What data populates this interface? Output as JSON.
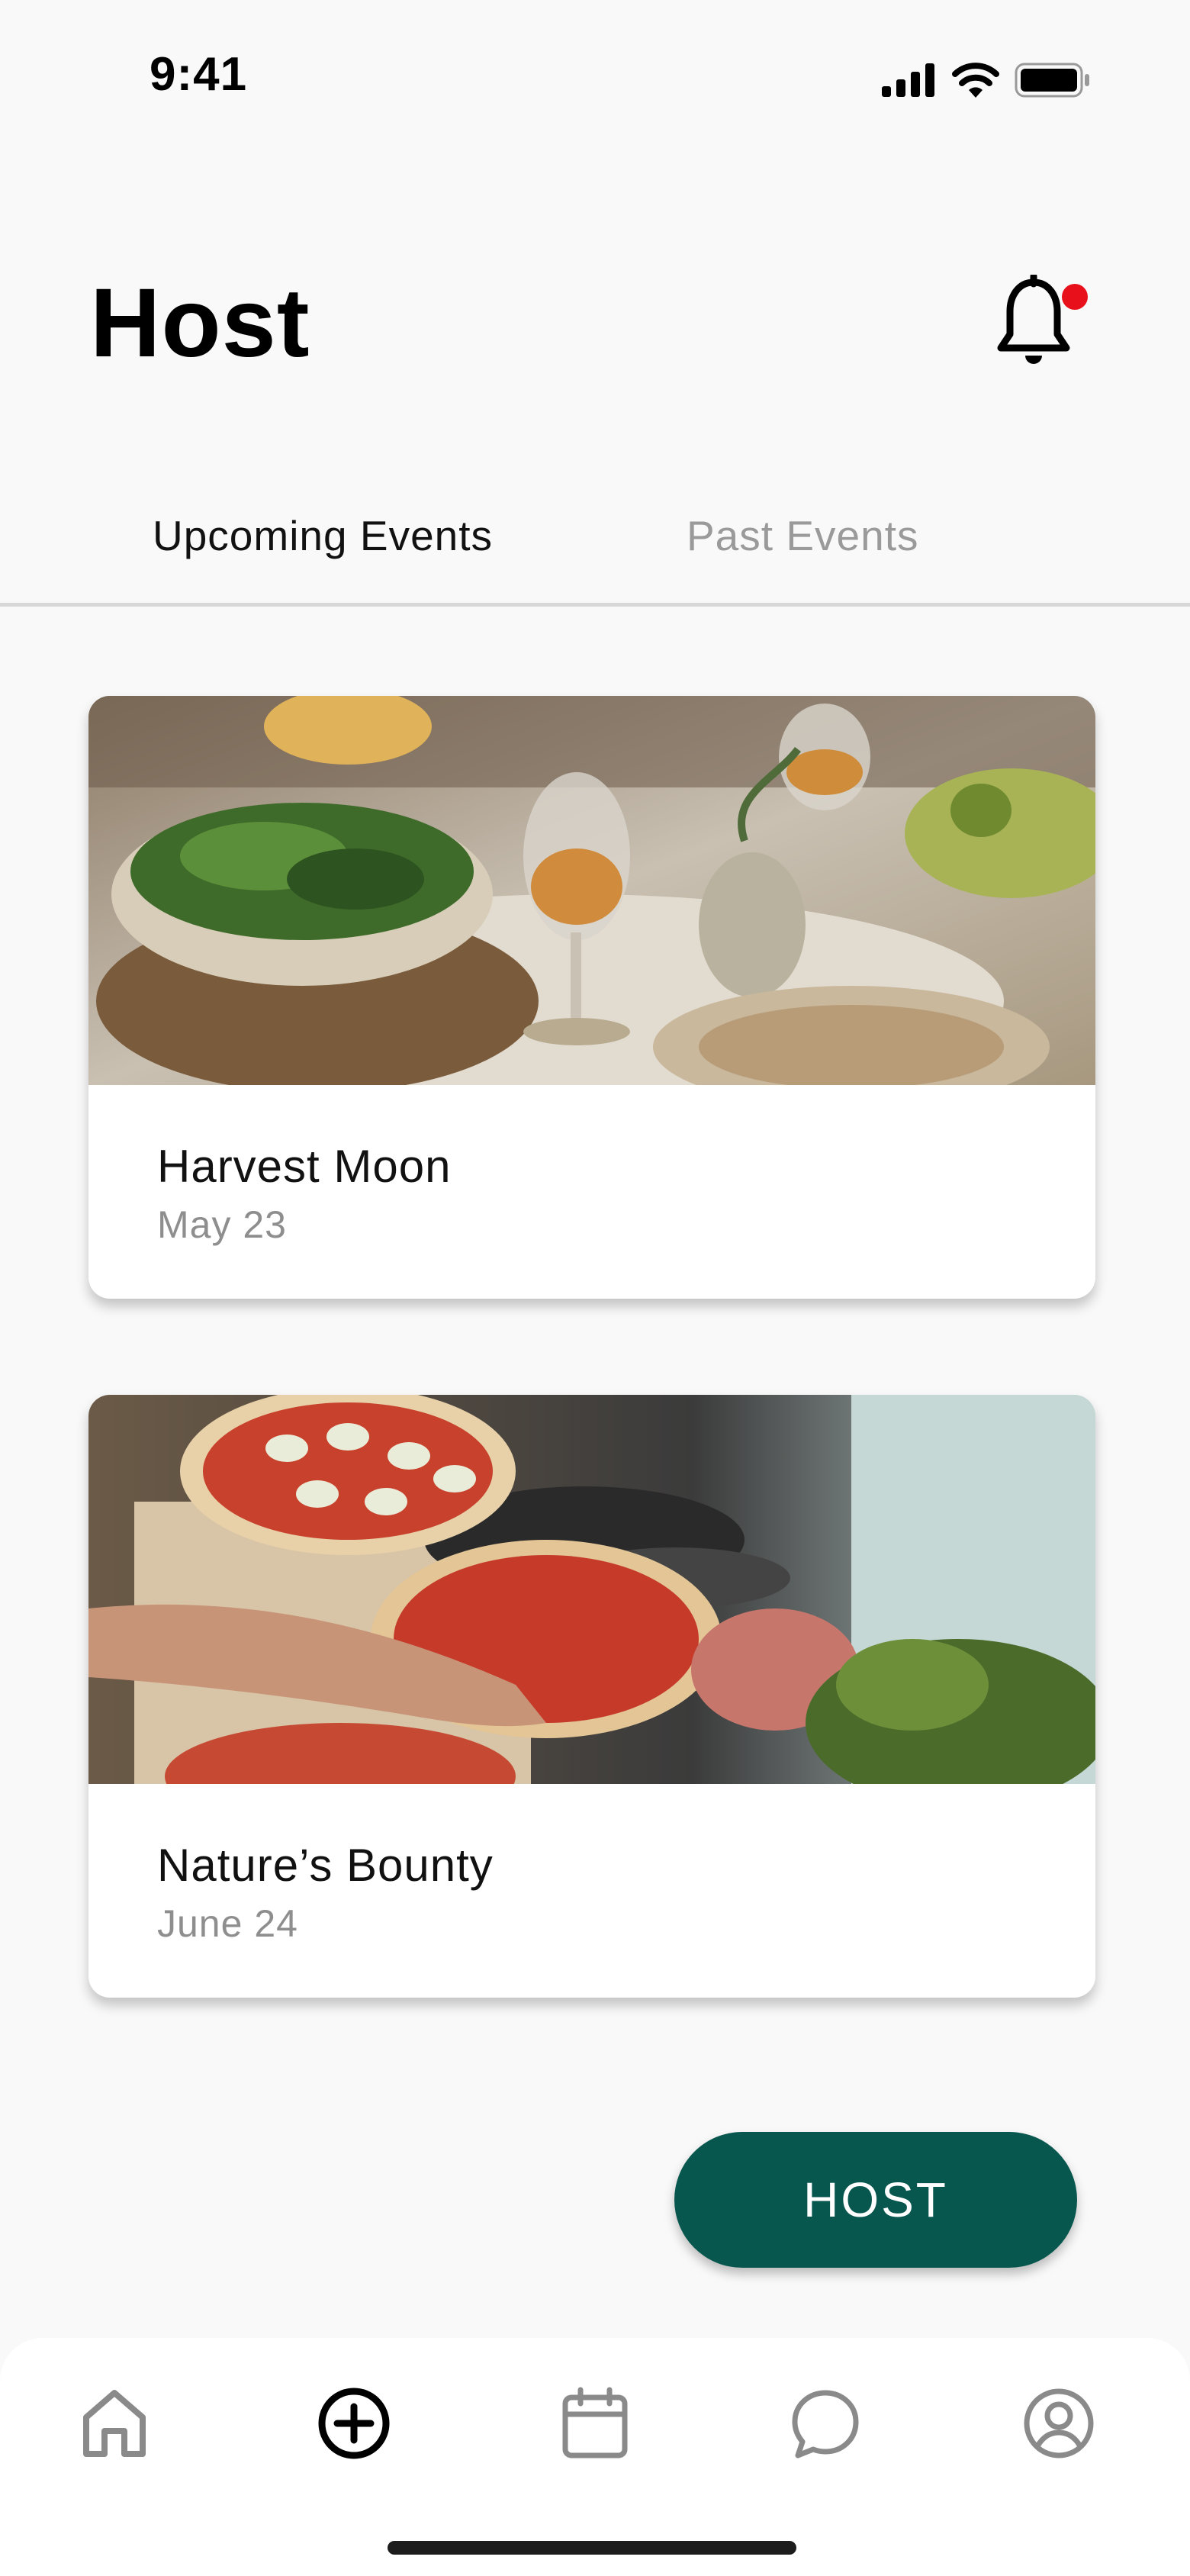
{
  "status_bar": {
    "time": "9:41",
    "icons": [
      "cellular-signal-icon",
      "wifi-icon",
      "battery-icon"
    ]
  },
  "header": {
    "title": "Host",
    "notification_icon": "bell-icon",
    "notification_badge_color": "#e8101b"
  },
  "tabs": [
    {
      "label": "Upcoming Events",
      "active": true
    },
    {
      "label": "Past Events",
      "active": false
    }
  ],
  "events": [
    {
      "title": "Harvest Moon",
      "date": "May 23",
      "image": "table-setting-photo"
    },
    {
      "title": "Nature’s Bounty",
      "date": "June 24",
      "image": "pizza-photo"
    }
  ],
  "host_button": {
    "label": "HOST",
    "color": "#07574f"
  },
  "bottom_nav": [
    {
      "icon": "home-icon",
      "active": false
    },
    {
      "icon": "add-circle-icon",
      "active": true
    },
    {
      "icon": "calendar-icon",
      "active": false
    },
    {
      "icon": "chat-bubble-icon",
      "active": false
    },
    {
      "icon": "profile-icon",
      "active": false
    }
  ],
  "colors": {
    "background": "#f9f9f9",
    "accent": "#07574f",
    "inactive_text": "#9a9a9a",
    "nav_icon_inactive": "#8a8a8a"
  }
}
